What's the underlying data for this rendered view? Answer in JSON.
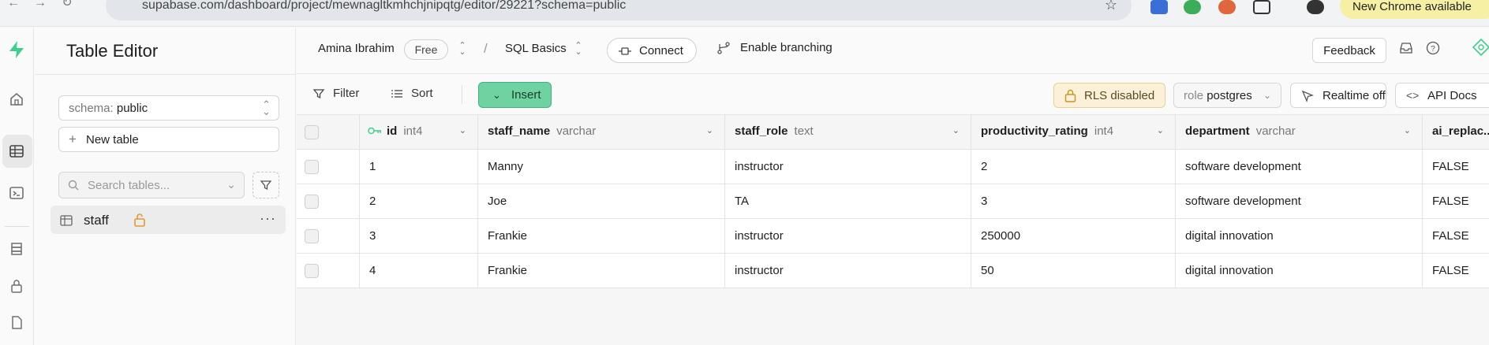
{
  "browser": {
    "url": "supabase.com/dashboard/project/mewnagltkmhchjnipqtg/editor/29221?schema=public",
    "chrome_pill": "New Chrome available"
  },
  "sidebar": {
    "title": "Table Editor",
    "schema_label": "schema:",
    "schema_value": "public",
    "new_table": "New table",
    "search_placeholder": "Search tables...",
    "tables": [
      {
        "name": "staff"
      }
    ]
  },
  "topbar": {
    "org": "Amina Ibrahim",
    "plan": "Free",
    "project": "SQL Basics",
    "connect": "Connect",
    "branching": "Enable branching",
    "feedback": "Feedback"
  },
  "toolbar": {
    "filter": "Filter",
    "sort": "Sort",
    "insert": "Insert",
    "rls": "RLS disabled",
    "role_key": "role",
    "role_value": "postgres",
    "realtime": "Realtime off",
    "api_docs": "API Docs"
  },
  "table": {
    "columns": [
      {
        "name": "id",
        "type": "int4"
      },
      {
        "name": "staff_name",
        "type": "varchar"
      },
      {
        "name": "staff_role",
        "type": "text"
      },
      {
        "name": "productivity_rating",
        "type": "int4"
      },
      {
        "name": "department",
        "type": "varchar"
      },
      {
        "name": "ai_replac...",
        "type": ""
      }
    ],
    "rows": [
      [
        "1",
        "Manny",
        "instructor",
        "2",
        "software development",
        "FALSE"
      ],
      [
        "2",
        "Joe",
        "TA",
        "3",
        "software development",
        "FALSE"
      ],
      [
        "3",
        "Frankie",
        "instructor",
        "250000",
        "digital innovation",
        "FALSE"
      ],
      [
        "4",
        "Frankie",
        "instructor",
        "50",
        "digital innovation",
        "FALSE"
      ]
    ]
  },
  "colors": {
    "brand_green": "#3ecf8e",
    "insert_bg": "#6ed3a1",
    "rls_bg": "#fbf1d8"
  }
}
